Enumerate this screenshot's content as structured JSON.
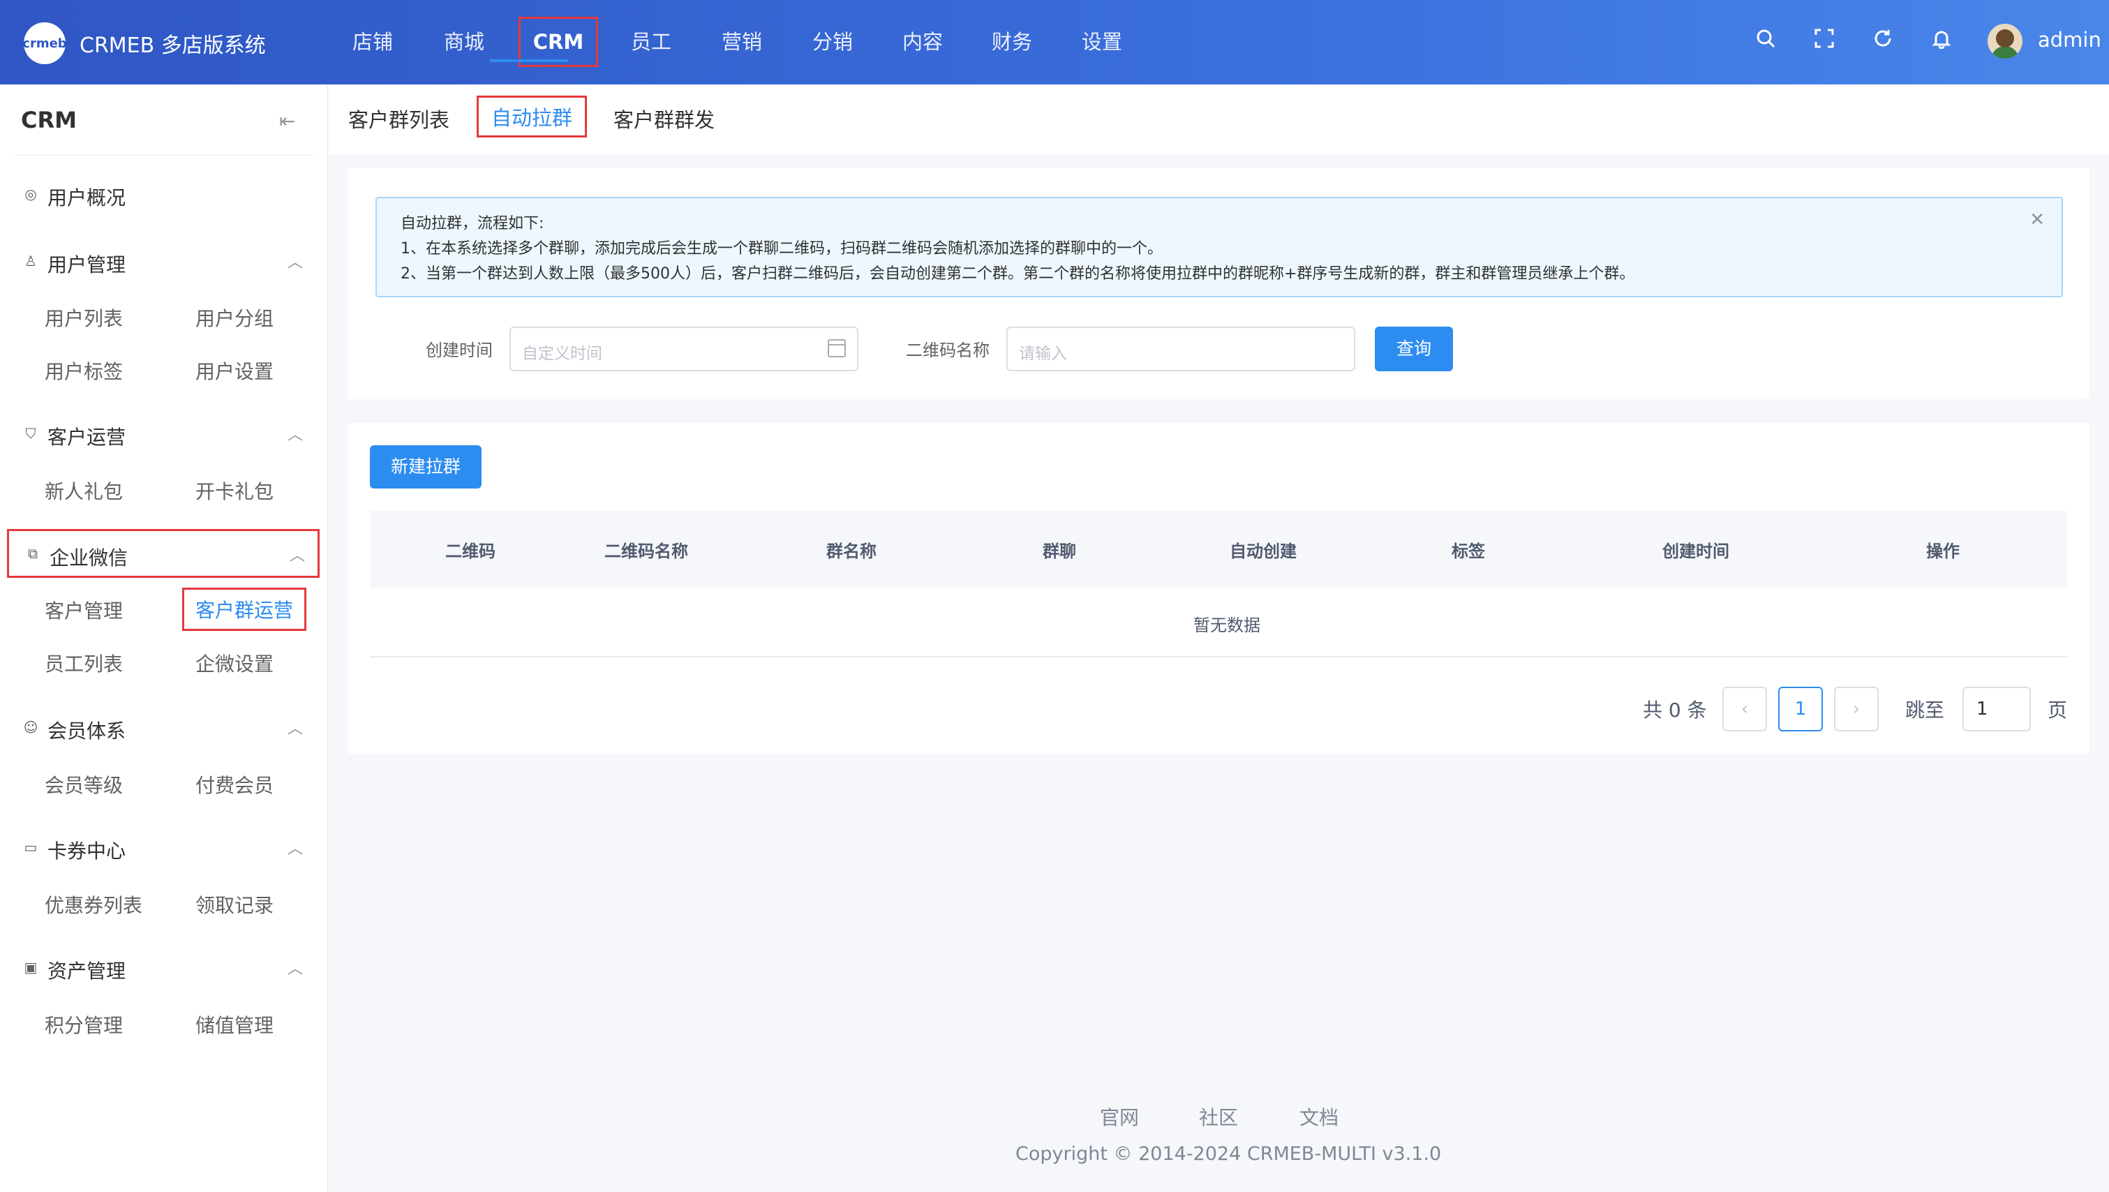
{
  "header": {
    "logo_text": "crmeb",
    "brand": "CRMEB 多店版系统",
    "nav": [
      "店铺",
      "商城",
      "CRM",
      "员工",
      "营销",
      "分销",
      "内容",
      "财务",
      "设置"
    ],
    "active_nav": "CRM",
    "user": "admin"
  },
  "sidebar": {
    "title": "CRM",
    "groups": [
      {
        "label": "用户概况",
        "icon": "dashboard-icon",
        "items": []
      },
      {
        "label": "用户管理",
        "icon": "user-icon",
        "items": [
          "用户列表",
          "用户分组",
          "用户标签",
          "用户设置"
        ]
      },
      {
        "label": "客户运营",
        "icon": "gift-icon",
        "items": [
          "新人礼包",
          "开卡礼包"
        ]
      },
      {
        "label": "企业微信",
        "icon": "chat-icon",
        "items": [
          "客户管理",
          "客户群运营",
          "员工列表",
          "企微设置"
        ]
      },
      {
        "label": "会员体系",
        "icon": "member-icon",
        "items": [
          "会员等级",
          "付费会员"
        ]
      },
      {
        "label": "卡券中心",
        "icon": "card-icon",
        "items": [
          "优惠券列表",
          "领取记录"
        ]
      },
      {
        "label": "资产管理",
        "icon": "asset-icon",
        "items": [
          "积分管理",
          "储值管理"
        ]
      }
    ],
    "active_item": "客户群运营"
  },
  "tabs": [
    "客户群列表",
    "自动拉群",
    "客户群群发"
  ],
  "active_tab": "自动拉群",
  "alert": {
    "lines": [
      "自动拉群，流程如下:",
      "1、在本系统选择多个群聊，添加完成后会生成一个群聊二维码，扫码群二维码会随机添加选择的群聊中的一个。",
      "2、当第一个群达到人数上限（最多500人）后，客户扫群二维码后，会自动创建第二个群。第二个群的名称将使用拉群中的群昵称+群序号生成新的群，群主和群管理员继承上个群。"
    ]
  },
  "filters": {
    "created_label": "创建时间",
    "created_placeholder": "自定义时间",
    "qr_name_label": "二维码名称",
    "qr_name_placeholder": "请输入",
    "search_button": "查询"
  },
  "table": {
    "new_button": "新建拉群",
    "columns": [
      "二维码",
      "二维码名称",
      "群名称",
      "群聊",
      "自动创建",
      "标签",
      "创建时间",
      "操作"
    ],
    "empty_text": "暂无数据"
  },
  "pagination": {
    "total_text": "共 0 条",
    "current_page": "1",
    "jump_label": "跳至",
    "jump_value": "1",
    "page_unit": "页"
  },
  "footer": {
    "links": [
      "官网",
      "社区",
      "文档"
    ],
    "copyright": "Copyright © 2014-2024 CRMEB-MULTI v3.1.0"
  },
  "colors": {
    "header_start": "#2f56c4",
    "header_end": "#4a86ea",
    "primary": "#2d8cf0",
    "highlight_border": "#e4393c"
  }
}
